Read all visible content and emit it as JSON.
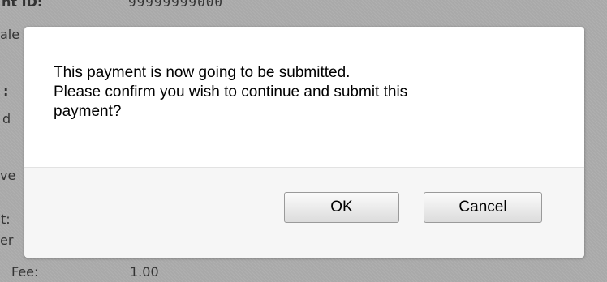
{
  "background": {
    "header_label": "nt ID:",
    "header_value": "99999999000",
    "partial_row_label": "ale",
    "colon_label": ":",
    "d_label": "d",
    "ve_label": "ve",
    "t_label": "t:",
    "er_label": "er",
    "fee_label": "Fee:",
    "fee_value": "1.00"
  },
  "dialog": {
    "message_line1": "This payment is now going to be submitted.",
    "message_line2": "Please confirm you wish to continue and submit this",
    "message_line3": "payment?",
    "ok_label": "OK",
    "cancel_label": "Cancel"
  }
}
